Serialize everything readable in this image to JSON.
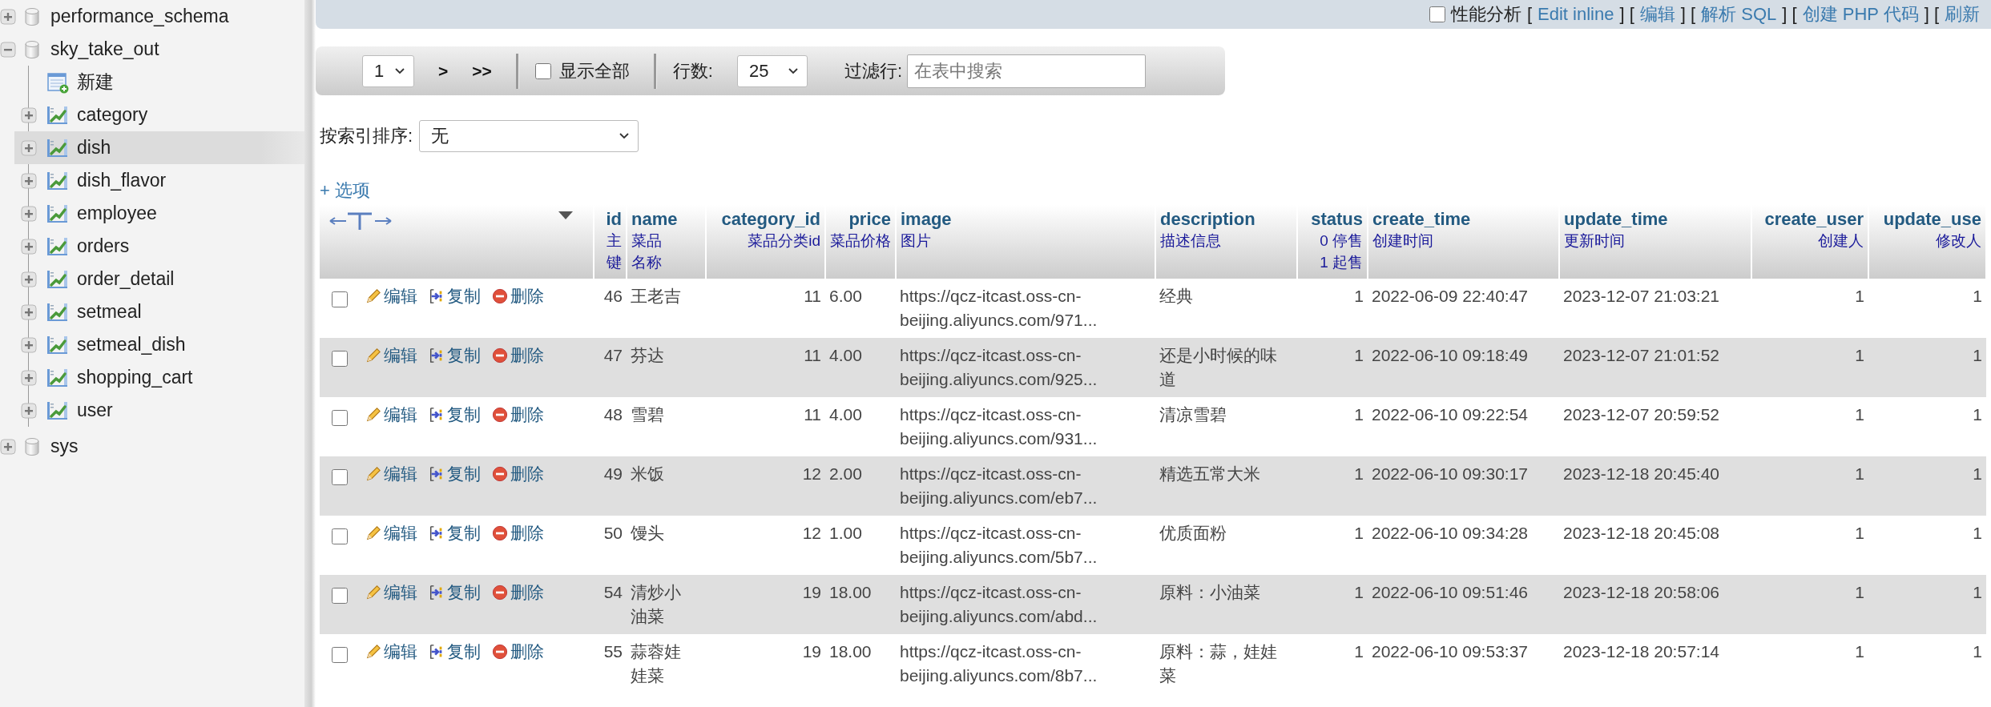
{
  "sidebar": {
    "databases": [
      {
        "name": "performance_schema",
        "expanded": false
      },
      {
        "name": "sky_take_out",
        "expanded": true,
        "children": [
          {
            "kind": "new",
            "name": "新建",
            "selected": false
          },
          {
            "kind": "table",
            "name": "category",
            "expanded": false,
            "selected": false
          },
          {
            "kind": "table",
            "name": "dish",
            "expanded": false,
            "selected": true
          },
          {
            "kind": "table",
            "name": "dish_flavor",
            "expanded": false,
            "selected": false
          },
          {
            "kind": "table",
            "name": "employee",
            "expanded": false,
            "selected": false
          },
          {
            "kind": "table",
            "name": "orders",
            "expanded": false,
            "selected": false
          },
          {
            "kind": "table",
            "name": "order_detail",
            "expanded": false,
            "selected": false
          },
          {
            "kind": "table",
            "name": "setmeal",
            "expanded": false,
            "selected": false
          },
          {
            "kind": "table",
            "name": "setmeal_dish",
            "expanded": false,
            "selected": false
          },
          {
            "kind": "table",
            "name": "shopping_cart",
            "expanded": false,
            "selected": false
          },
          {
            "kind": "table",
            "name": "user",
            "expanded": false,
            "selected": false
          }
        ]
      },
      {
        "name": "sys",
        "expanded": false
      }
    ]
  },
  "top_bar": {
    "profiling": {
      "label": "性能分析",
      "checked": false
    },
    "items": [
      {
        "kind": "bracket",
        "text": "["
      },
      {
        "kind": "link",
        "text": "Edit inline"
      },
      {
        "kind": "bracket",
        "text": "] ["
      },
      {
        "kind": "link",
        "text": "编辑"
      },
      {
        "kind": "bracket",
        "text": "] ["
      },
      {
        "kind": "link",
        "text": "解析 SQL"
      },
      {
        "kind": "bracket",
        "text": "] ["
      },
      {
        "kind": "link",
        "text": "创建 PHP 代码"
      },
      {
        "kind": "bracket",
        "text": "] ["
      },
      {
        "kind": "link",
        "text": "刷新"
      }
    ]
  },
  "navigation": {
    "page": "1",
    "next": ">",
    "last": ">>",
    "show_all": {
      "label": "显示全部",
      "checked": false
    },
    "rows_label": "行数:",
    "rows_value": "25",
    "filter_label": "过滤行:",
    "filter_placeholder": "在表中搜索"
  },
  "sort": {
    "label": "按索引排序:",
    "value": "无"
  },
  "options_link": "+ 选项",
  "table": {
    "columns": [
      {
        "name": "id",
        "comment": "主键"
      },
      {
        "name": "name",
        "comment": "菜品名称"
      },
      {
        "name": "category_id",
        "comment": "菜品分类id"
      },
      {
        "name": "price",
        "comment": "菜品价格"
      },
      {
        "name": "image",
        "comment": "图片"
      },
      {
        "name": "description",
        "comment": "描述信息"
      },
      {
        "name": "status",
        "comment": "0 停售 1 起售"
      },
      {
        "name": "create_time",
        "comment": "创建时间"
      },
      {
        "name": "update_time",
        "comment": "更新时间"
      },
      {
        "name": "create_user",
        "comment": "创建人"
      },
      {
        "name": "update_use",
        "comment": "修改人"
      }
    ],
    "rows": [
      {
        "checked": false,
        "actions": [
          "编辑",
          "复制",
          "删除"
        ],
        "cells": [
          "46",
          "王老吉",
          "11",
          "6.00",
          "https://qcz-itcast.oss-cn-beijing.aliyuncs.com/971...",
          "经典",
          "1",
          "2022-06-09 22:40:47",
          "2023-12-07 21:03:21",
          "1",
          "1"
        ]
      },
      {
        "checked": false,
        "actions": [
          "编辑",
          "复制",
          "删除"
        ],
        "cells": [
          "47",
          "芬达",
          "11",
          "4.00",
          "https://qcz-itcast.oss-cn-beijing.aliyuncs.com/925...",
          "还是小时候的味道",
          "1",
          "2022-06-10 09:18:49",
          "2023-12-07 21:01:52",
          "1",
          "1"
        ]
      },
      {
        "checked": false,
        "actions": [
          "编辑",
          "复制",
          "删除"
        ],
        "cells": [
          "48",
          "雪碧",
          "11",
          "4.00",
          "https://qcz-itcast.oss-cn-beijing.aliyuncs.com/931...",
          "清凉雪碧",
          "1",
          "2022-06-10 09:22:54",
          "2023-12-07 20:59:52",
          "1",
          "1"
        ]
      },
      {
        "checked": false,
        "actions": [
          "编辑",
          "复制",
          "删除"
        ],
        "cells": [
          "49",
          "米饭",
          "12",
          "2.00",
          "https://qcz-itcast.oss-cn-beijing.aliyuncs.com/eb7...",
          "精选五常大米",
          "1",
          "2022-06-10 09:30:17",
          "2023-12-18 20:45:40",
          "1",
          "1"
        ]
      },
      {
        "checked": false,
        "actions": [
          "编辑",
          "复制",
          "删除"
        ],
        "cells": [
          "50",
          "馒头",
          "12",
          "1.00",
          "https://qcz-itcast.oss-cn-beijing.aliyuncs.com/5b7...",
          "优质面粉",
          "1",
          "2022-06-10 09:34:28",
          "2023-12-18 20:45:08",
          "1",
          "1"
        ]
      },
      {
        "checked": false,
        "actions": [
          "编辑",
          "复制",
          "删除"
        ],
        "cells": [
          "54",
          "清炒小油菜",
          "19",
          "18.00",
          "https://qcz-itcast.oss-cn-beijing.aliyuncs.com/abd...",
          "原料：小油菜",
          "1",
          "2022-06-10 09:51:46",
          "2023-12-18 20:58:06",
          "1",
          "1"
        ]
      },
      {
        "checked": false,
        "actions": [
          "编辑",
          "复制",
          "删除"
        ],
        "cells": [
          "55",
          "蒜蓉娃娃菜",
          "19",
          "18.00",
          "https://qcz-itcast.oss-cn-beijing.aliyuncs.com/8b7...",
          "原料：蒜，娃娃菜",
          "1",
          "2022-06-10 09:53:37",
          "2023-12-18 20:57:14",
          "1",
          "1"
        ]
      }
    ]
  }
}
